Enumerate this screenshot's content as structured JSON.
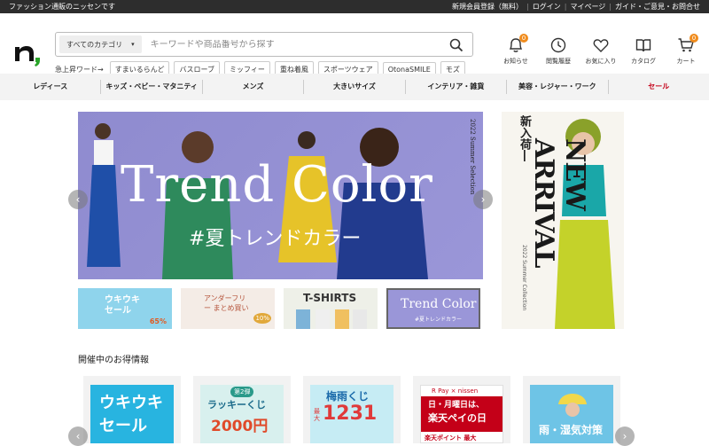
{
  "topbar": {
    "tagline": "ファッション通販のニッセンです",
    "links": [
      "新規会員登録（無料）",
      "ログイン",
      "マイページ",
      "ガイド・ご意見・お問合せ"
    ]
  },
  "search": {
    "category": "すべてのカテゴリ",
    "placeholder": "キーワードや商品番号から探す"
  },
  "trending": {
    "label": "急上昇ワード→",
    "chips": [
      "すまいるらんど",
      "バスローブ",
      "ミッフィー",
      "重ね着風",
      "スポーツウェア",
      "OtonaSMILE",
      "モズ"
    ]
  },
  "header_icons": [
    {
      "name": "bell-icon",
      "label": "お知らせ",
      "badge": "0"
    },
    {
      "name": "clock-icon",
      "label": "閲覧履歴"
    },
    {
      "name": "heart-icon",
      "label": "お気に入り"
    },
    {
      "name": "book-icon",
      "label": "カタログ"
    },
    {
      "name": "cart-icon",
      "label": "カート",
      "badge": "0"
    }
  ],
  "categories": [
    "レディース",
    "キッズ・ベビー・マタニティ",
    "メンズ",
    "大きいサイズ",
    "インテリア・雑貨",
    "美容・レジャー・ワーク",
    "セール"
  ],
  "hero": {
    "title": "Trend Color",
    "subtitle": "#夏トレンドカラー",
    "side_text": "2022 Summer Selection"
  },
  "side_banner": {
    "new_label": "新入荷―",
    "big_text": "NEW ARRIVAL",
    "sub_text": "2022 Summer Collection"
  },
  "thumbnails": [
    {
      "title": "ウキウキ セール",
      "note": "65%"
    },
    {
      "title": "アンダーフリー まとめ買い",
      "note": "10%"
    },
    {
      "title": "T-SHIRTS",
      "note": ""
    },
    {
      "title": "Trend Color",
      "note": "#夏トレンドカラー"
    }
  ],
  "section_title": "開催中のお得情報",
  "cards": [
    {
      "line1": "ウキウキ",
      "line2": "セール"
    },
    {
      "line1": "第2弾",
      "line2": "ラッキーくじ",
      "line3": "2000円"
    },
    {
      "line1": "梅雨くじ",
      "line2": "1231",
      "line3": "最大"
    },
    {
      "line1": "R Pay × nissen",
      "line2": "日・月曜日は、",
      "line3": "楽天ペイの日",
      "line4": "楽天ポイント 最大"
    },
    {
      "line1": "雨・湿気対策"
    }
  ],
  "colors": {
    "topbar": "#2d2d2d",
    "accent_orange": "#f08c1e",
    "sale_red": "#c40018",
    "hero_bg": "#8f8bcf"
  }
}
